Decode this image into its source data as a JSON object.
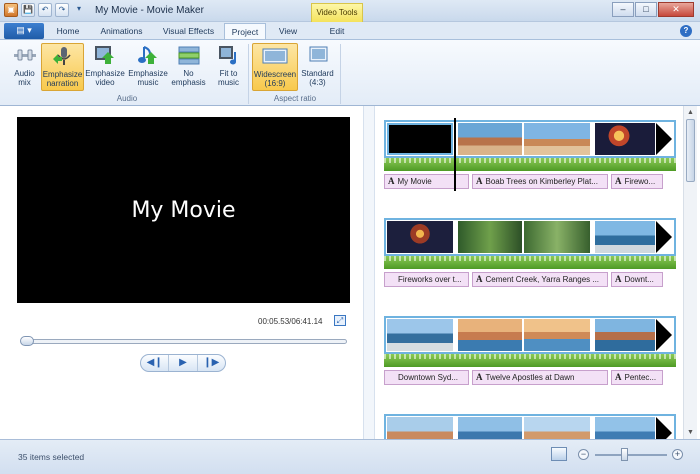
{
  "window": {
    "title": "My Movie - Movie Maker",
    "contextual_tab": "Video Tools",
    "controls": {
      "minimize": "–",
      "maximize": "□",
      "close": "✕"
    }
  },
  "qat": [
    "💾",
    "↶",
    "↷",
    "▾"
  ],
  "tabs": [
    {
      "label": "Home",
      "active": false
    },
    {
      "label": "Animations",
      "active": false
    },
    {
      "label": "Visual Effects",
      "active": false
    },
    {
      "label": "Project",
      "active": true
    },
    {
      "label": "View",
      "active": false
    },
    {
      "label": "Edit",
      "active": false
    }
  ],
  "ribbon": {
    "audio_group": {
      "label": "Audio",
      "buttons": [
        {
          "line1": "Audio",
          "line2": "mix",
          "icon": "audio-mix-icon"
        },
        {
          "line1": "Emphasize",
          "line2": "narration",
          "icon": "narration-mic-icon",
          "selected": true
        },
        {
          "line1": "Emphasize",
          "line2": "video",
          "icon": "video-up-icon"
        },
        {
          "line1": "Emphasize",
          "line2": "music",
          "icon": "music-up-icon"
        },
        {
          "line1": "No",
          "line2": "emphasis",
          "icon": "no-emphasis-icon"
        },
        {
          "line1": "Fit to",
          "line2": "music",
          "icon": "fit-to-music-icon"
        }
      ]
    },
    "aspect_group": {
      "label": "Aspect ratio",
      "buttons": [
        {
          "line1": "Widescreen",
          "line2": "(16:9)",
          "icon": "widescreen-icon",
          "selected": true
        },
        {
          "line1": "Standard",
          "line2": "(4:3)",
          "icon": "standard-icon"
        }
      ]
    }
  },
  "preview": {
    "title_text": "My Movie",
    "timecode": "00:05.53/06:41.14",
    "seek_fraction": 0.015,
    "controls": [
      "◀❙",
      "▶",
      "❙▶"
    ]
  },
  "storyboard": {
    "rows": [
      {
        "captions": [
          "My Movie",
          "Boab Trees on Kimberley Plat...",
          "Firewo..."
        ]
      },
      {
        "captions": [
          "Fireworks over t...",
          "Cement Creek, Yarra Ranges ...",
          "Downt..."
        ]
      },
      {
        "captions": [
          "Downtown Syd...",
          "Twelve Apostles at Dawn",
          "Pentec..."
        ]
      }
    ]
  },
  "status": {
    "text": "35 items selected",
    "zoom_fraction": 0.4
  },
  "colors": {
    "selected_bg": "#f8c94c",
    "caption_bg": "#f3e1f6",
    "strip_border": "#6fb3e0",
    "audio_wave": "#4e9a25"
  }
}
